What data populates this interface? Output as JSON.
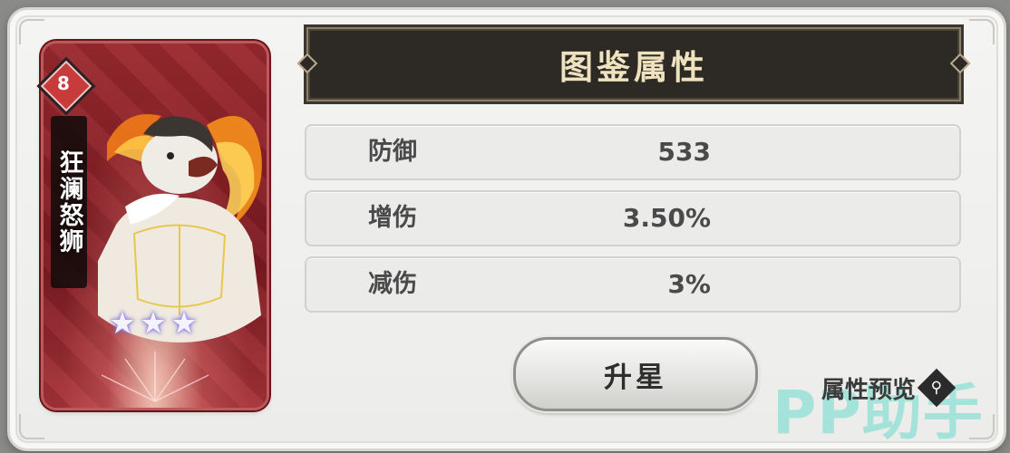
{
  "card": {
    "name": "狂澜怒狮",
    "level": "8",
    "stars": 3
  },
  "panel": {
    "title": "图鉴属性",
    "attributes": [
      {
        "label": "防御",
        "value": "533"
      },
      {
        "label": "增伤",
        "value": "3.50%"
      },
      {
        "label": "减伤",
        "value": "3%"
      }
    ],
    "upgrade_button": "升星",
    "preview_link": "属性预览",
    "preview_icon": "search-icon"
  },
  "watermark": "PP助手",
  "colors": {
    "title_bg": "#2d2a25",
    "title_text": "#efe3bf",
    "card_bg": "#8a2026"
  }
}
